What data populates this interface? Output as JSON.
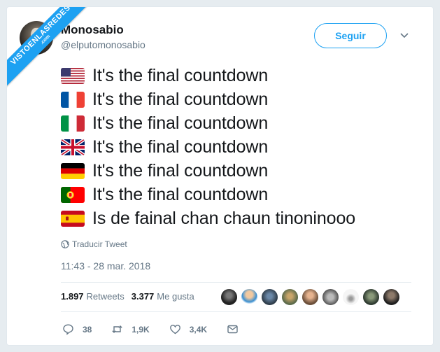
{
  "watermark": {
    "line1": "VISTOENLASREDES",
    "line2": ".com"
  },
  "author": {
    "name": "Monosabio",
    "handle": "@elputomonosabio"
  },
  "follow_label": "Seguir",
  "lines": [
    {
      "flag": "flag-usa-icon",
      "text": "It's the final countdown"
    },
    {
      "flag": "flag-france-icon",
      "text": "It's the final countdown"
    },
    {
      "flag": "flag-italy-icon",
      "text": "It's the final countdown"
    },
    {
      "flag": "flag-uk-icon",
      "text": "It's the final countdown"
    },
    {
      "flag": "flag-germany-icon",
      "text": "It's the final countdown"
    },
    {
      "flag": "flag-portugal-icon",
      "text": "It's the final countdown"
    },
    {
      "flag": "flag-spain-icon",
      "text": "Is de fainal chan chaun tinoninooo"
    }
  ],
  "translate_label": "Traducir Tweet",
  "timestamp": "11:43 - 28 mar. 2018",
  "stats": {
    "retweets_count": "1.897",
    "retweets_label": "Retweets",
    "likes_count": "3.377",
    "likes_label": "Me gusta"
  },
  "actions": {
    "replies": "38",
    "retweets": "1,9K",
    "likes": "3,4K"
  },
  "colors": {
    "accent": "#1da1f2",
    "muted": "#657786",
    "text": "#14171a"
  }
}
